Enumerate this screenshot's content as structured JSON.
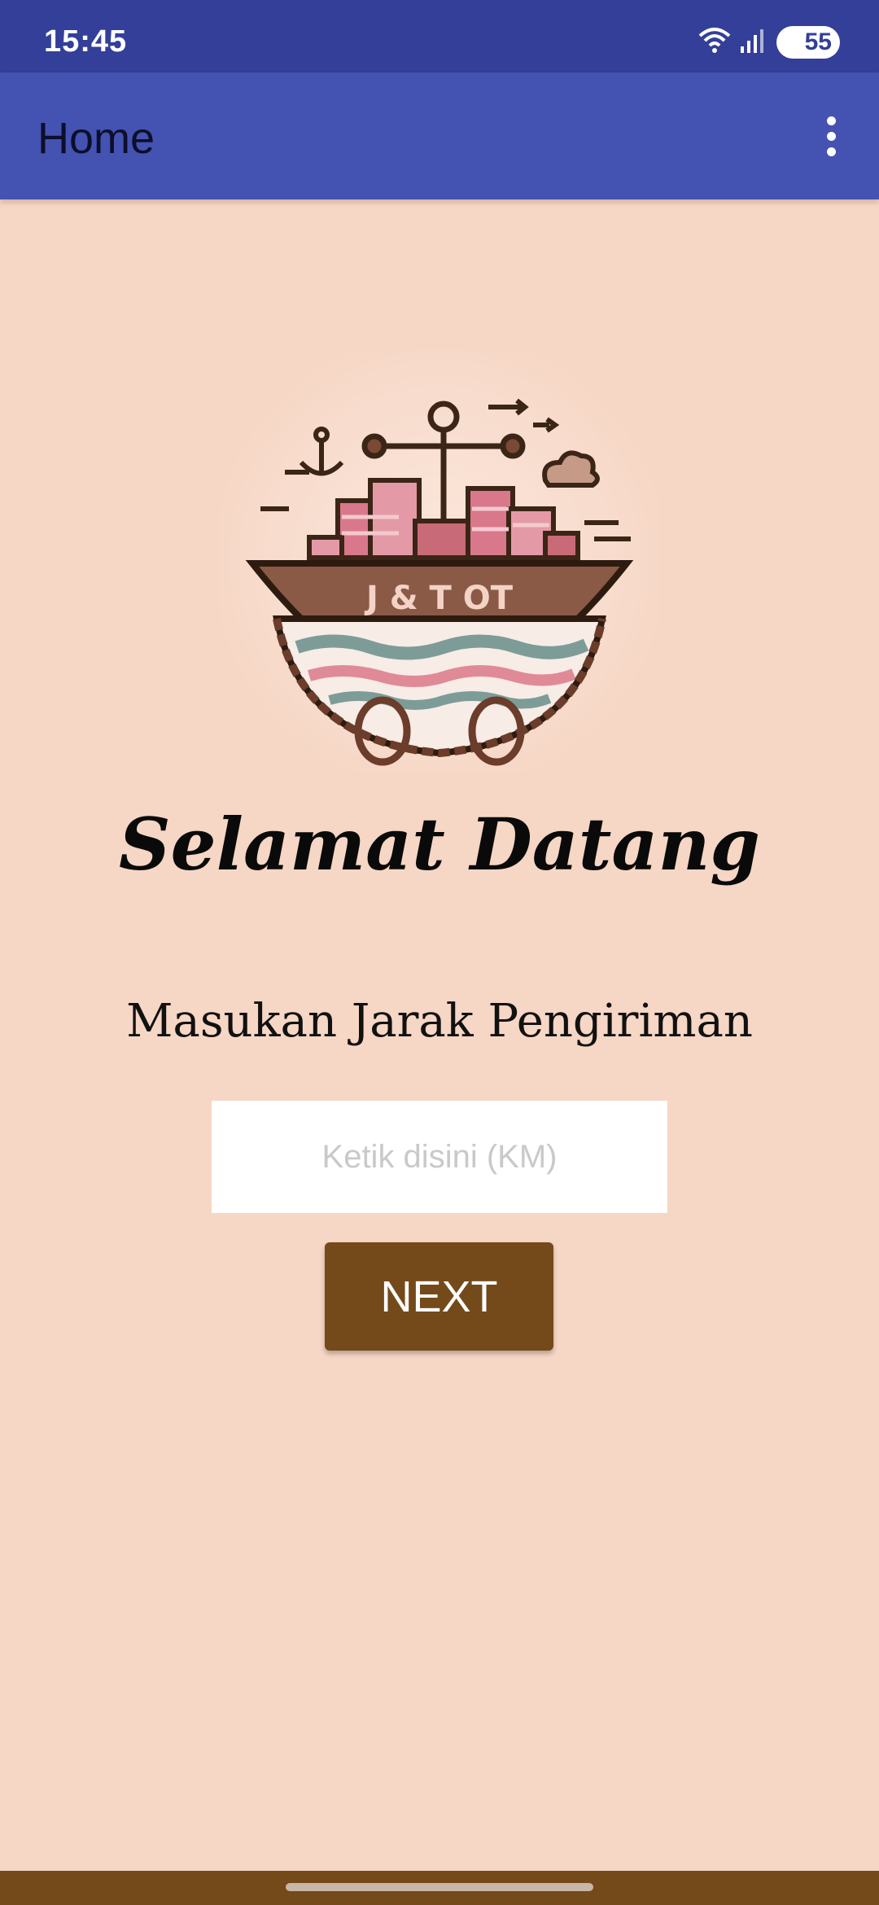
{
  "status_bar": {
    "time": "15:45",
    "battery": "55",
    "icons": [
      "wifi-icon",
      "signal-icon",
      "battery-icon"
    ]
  },
  "app_bar": {
    "title": "Home",
    "menu_icon": "overflow-menu-icon"
  },
  "logo": {
    "text": "J & T OT",
    "icon": "cargo-ship-logo"
  },
  "main": {
    "welcome": "Selamat Datang",
    "prompt": "Masukan Jarak Pengiriman",
    "distance_input": {
      "value": "",
      "placeholder": "Ketik disini (KM)"
    },
    "next_button": "NEXT"
  },
  "colors": {
    "status_bar": "#333f98",
    "app_bar": "#4452b2",
    "background": "#f6d6c4",
    "button": "#744a1b"
  }
}
